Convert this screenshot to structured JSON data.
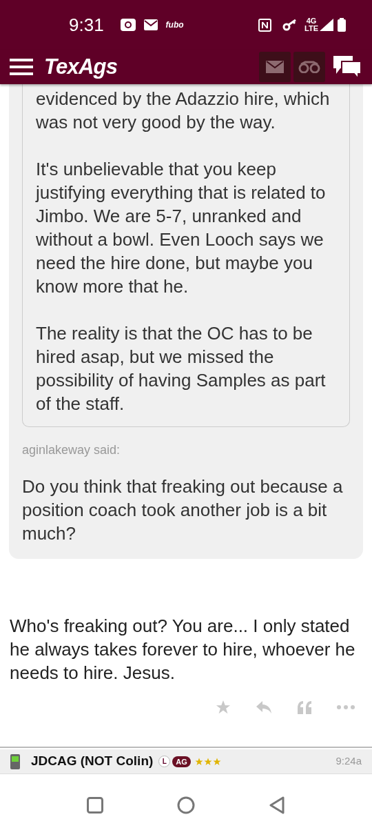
{
  "status_bar": {
    "time": "9:31",
    "app_label": "fubo",
    "network": "4G",
    "network_sub": "LTE"
  },
  "header": {
    "logo": "TexAgs"
  },
  "quote": {
    "inner_paragraphs": [
      "evidenced by the Adazzio hire, which was not very good by the way.",
      "It's unbelievable that you keep justifying everything that is related to Jimbo. We are 5-7, unranked and without a bowl. Even Looch says we need the hire done, but maybe you know more that he.",
      "The reality is that the OC has to be hired asap, but we missed the possibility of having Samples as part of the staff."
    ],
    "author_line": "aginlakeway said:",
    "text": "Do you think that freaking out because a position coach took another job is a bit much?"
  },
  "reply": "Who's freaking out? You are... I only stated he always takes forever to hire, whoever he needs to hire. Jesus.",
  "user": {
    "name": "JDCAG (NOT Colin)",
    "badges": [
      {
        "label": "L",
        "kind": "outline"
      },
      {
        "label": "AG",
        "kind": "filled"
      }
    ],
    "stars": 3,
    "time": "9:24a"
  }
}
